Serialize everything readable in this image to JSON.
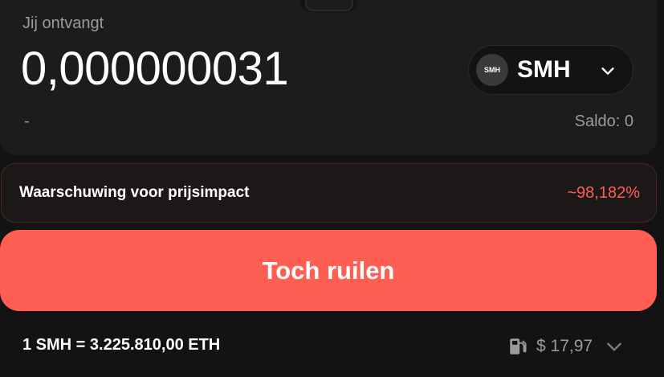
{
  "receive": {
    "label": "Jij ontvangt",
    "amount": "0,000000031",
    "usd_value": "-",
    "balance": "Saldo: 0"
  },
  "token": {
    "symbol": "SMH",
    "logo_text": "SMH",
    "icon": "chevron-down-icon"
  },
  "warning": {
    "label": "Waarschuwing voor prijsimpact",
    "value": "~98,182%"
  },
  "swap_button": {
    "label": "Toch ruilen"
  },
  "footer": {
    "rate": "1 SMH = 3.225.810,00 ETH",
    "gas_icon": "gas-pump-icon",
    "gas_fee": "$ 17,97",
    "details_icon": "chevron-down-icon"
  },
  "colors": {
    "background": "#131313",
    "card": "#1c1c1c",
    "accent_red": "#ff5f52",
    "muted_text": "#9b9b9b"
  }
}
